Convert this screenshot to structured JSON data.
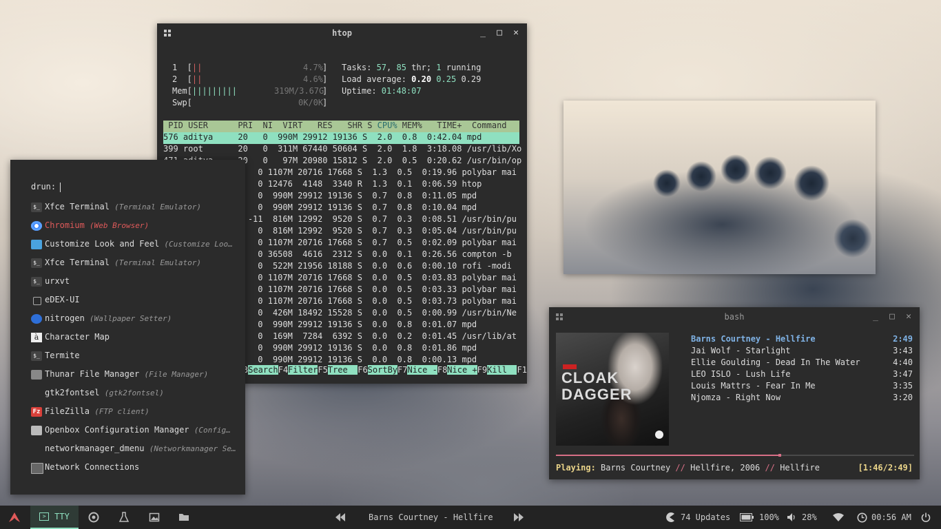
{
  "htop": {
    "title": "htop",
    "meters": {
      "cpu1_label": "1  [",
      "cpu1_bar": "||",
      "cpu1_val": "4.7%",
      "cpu1_end": "]",
      "cpu2_label": "2  [",
      "cpu2_bar": "||",
      "cpu2_val": "4.6%",
      "cpu2_end": "]",
      "mem_label": "Mem[",
      "mem_bar": "|||||||||",
      "mem_val": "319M/3.67G",
      "mem_end": "]",
      "swp_label": "Swp[",
      "swp_bar": "",
      "swp_val": "0K/0K",
      "swp_end": "]"
    },
    "tasks_label": "Tasks: ",
    "tasks_count": "57",
    "tasks_sep": ", ",
    "threads": "85",
    "tasks_rest": " thr; ",
    "running": "1",
    "running_label": " running",
    "load_label": "Load average: ",
    "load1": "0.20",
    "load5": "0.25",
    "load15": "0.29",
    "uptime_label": "Uptime: ",
    "uptime": "01:48:07",
    "header_pre": "PID USER      PRI  NI  VIRT   RES   SHR S ",
    "header_sort": "CPU%",
    "header_post": " MEM%   TIME+  Command",
    "selected": "576 aditya     20   0  990M 29912 19136 S  2.0  0.8  0:42.04 mpd",
    "rows": [
      "399 root       20   0  311M 67440 50604 S  2.0  1.8  3:18.08 /usr/lib/Xo",
      "471 aditya     20   0   97M 20980 15812 S  2.0  0.5  0:20.62 /usr/bin/op",
      "              20   0 1107M 20716 17668 S  1.3  0.5  0:19.96 polybar mai",
      "              20   0 12476  4148  3340 R  1.3  0.1  0:06.59 htop",
      "              20   0  990M 29912 19136 S  0.7  0.8  0:11.05 mpd",
      "              20   0  990M 29912 19136 S  0.7  0.8  0:10.04 mpd",
      "               9 -11  816M 12992  9520 S  0.7  0.3  0:08.51 /usr/bin/pu",
      "              -6   0  816M 12992  9520 S  0.7  0.3  0:05.04 /usr/bin/pu",
      "              20   0 1107M 20716 17668 S  0.7  0.5  0:02.09 polybar mai",
      "              20   0 36508  4616  2312 S  0.0  0.1  0:26.56 compton -b",
      "              20   0  522M 21956 18188 S  0.0  0.6  0:00.10 rofi -modi",
      "              20   0 1107M 20716 17668 S  0.0  0.5  0:03.83 polybar mai",
      "              20   0 1107M 20716 17668 S  0.0  0.5  0:03.33 polybar mai",
      "              20   0 1107M 20716 17668 S  0.0  0.5  0:03.73 polybar mai",
      "              20   0  426M 18492 15528 S  0.0  0.5  0:00.99 /usr/bin/Ne",
      "              20   0  990M 29912 19136 S  0.0  0.8  0:01.07 mpd",
      "              20   0  169M  7284  6392 S  0.0  0.2  0:01.45 /usr/lib/at",
      "              20   0  990M 29912 19136 S  0.0  0.8  0:01.86 mpd",
      "              20   0  990M 29912 19136 S  0.0  0.8  0:00.13 mpd"
    ],
    "fkeys": [
      {
        "k": "3",
        "l": "Search"
      },
      {
        "k": "F4",
        "l": "Filter"
      },
      {
        "k": "F5",
        "l": "Tree  "
      },
      {
        "k": "F6",
        "l": "SortBy"
      },
      {
        "k": "F7",
        "l": "Nice -"
      },
      {
        "k": "F8",
        "l": "Nice +"
      },
      {
        "k": "F9",
        "l": "Kill  "
      },
      {
        "k": "F1",
        "l": ""
      }
    ]
  },
  "rofi": {
    "prompt": "drun:",
    "items": [
      {
        "label": "Xfce Terminal",
        "sub": "(Terminal Emulator)",
        "icon": "terminal-icon"
      },
      {
        "label": "Chromium",
        "sub": "(Web Browser)",
        "icon": "chromium-icon"
      },
      {
        "label": "Customize Look and Feel",
        "sub": "(Customize Loo…",
        "icon": "appearance-icon"
      },
      {
        "label": "Xfce Terminal",
        "sub": "(Terminal Emulator)",
        "icon": "terminal-icon"
      },
      {
        "label": "urxvt",
        "sub": "",
        "icon": "terminal-icon"
      },
      {
        "label": "eDEX-UI",
        "sub": "",
        "icon": "edex-icon"
      },
      {
        "label": "nitrogen",
        "sub": "(Wallpaper Setter)",
        "icon": "nitrogen-icon"
      },
      {
        "label": "Character Map",
        "sub": "",
        "icon": "charmap-icon"
      },
      {
        "label": "Termite",
        "sub": "",
        "icon": "terminal-icon"
      },
      {
        "label": "Thunar File Manager",
        "sub": "(File Manager)",
        "icon": "file-manager-icon"
      },
      {
        "label": "gtk2fontsel",
        "sub": "(gtk2fontsel)",
        "icon": ""
      },
      {
        "label": "FileZilla",
        "sub": "(FTP client)",
        "icon": "filezilla-icon"
      },
      {
        "label": "Openbox Configuration Manager",
        "sub": "(Config…",
        "icon": "openbox-icon"
      },
      {
        "label": "networkmanager_dmenu",
        "sub": "(Networkmanager Se…",
        "icon": ""
      },
      {
        "label": "Network Connections",
        "sub": "",
        "icon": "network-icon"
      }
    ]
  },
  "player": {
    "title": "bash",
    "playlist": [
      {
        "track": "Barns Courtney - Hellfire",
        "time": "2:49",
        "current": true
      },
      {
        "track": "Jai Wolf - Starlight",
        "time": "3:43"
      },
      {
        "track": "Ellie Goulding - Dead In The Water",
        "time": "4:40"
      },
      {
        "track": "LEO ISLO - Lush Life",
        "time": "3:47"
      },
      {
        "track": "Louis Mattrs - Fear In Me",
        "time": "3:35"
      },
      {
        "track": "Njomza - Right Now",
        "time": "3:20"
      }
    ],
    "cover_text1": "CLOAK",
    "cover_text2": "DAGGER",
    "cover_brand": "MARVEL",
    "progress_fraction": 0.625,
    "playing_label": "Playing:",
    "artist": "Barns Courtney",
    "sep": "//",
    "album": "Hellfire, 2006",
    "title_song": "Hellfire",
    "elapsed": "[1:46/2:49]"
  },
  "taskbar": {
    "tty_label": "TTY",
    "now_playing": "Barns Courtney - Hellfire",
    "updates": "74 Updates",
    "battery": "100%",
    "volume": "28%",
    "clock": "00:56 AM"
  },
  "colors": {
    "accent": "#8fe0c0",
    "highlight_red": "#e05a5a",
    "progress": "#d76f86",
    "current_track": "#7fb2e5"
  }
}
